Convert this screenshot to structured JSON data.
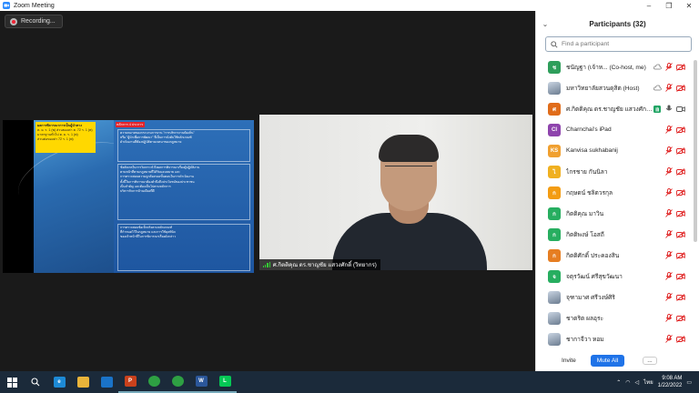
{
  "window": {
    "title": "Zoom Meeting",
    "controls": [
      "–",
      "❐",
      "✕"
    ]
  },
  "recording": {
    "label": "Recording..."
  },
  "share": {
    "left_box_lines": [
      "ผลการพิจารณาการเป็นผู้นำทาง",
      "ต. ย. ร. 1 (พ) ส่วนของค่า ต. 72 ร. 1 (พ)",
      "มาตรฐานทั่วไป ต. ย. ร. 1 (พ)",
      "ส่วนต่อของค่า 72 ร. 1 (พ)"
    ],
    "red_label": "หลักการ 4 ประการ",
    "blocks": [
      "ความหมายของกระบวนการงาน \"การบริหารงานท้องถิ่น\"\nหรือ \"ผู้นำเพื่อการพัฒนา\" ที่เป็นการบังคับใช้หลักเกณฑ์\nดำเนินงานที่ต้องปฏิบัติตามเจตนาของกฎหมาย",
      "ข้อสังเกตในการวิเคราะห์ ถึงผลการพิจารณาเรื่องผู้ปฏิบัติงาน\nตามหน้าที่ตามกฎหมายที่ได้รับมอบหมาย และ\nการตรวจสอบความถูกต้องของขั้นตอนในการดำเนินงาน\nทั้งนี้ในการพิจารณาต้องคำนึงถึงประโยชน์ของประชาชน\nเป็นสำคัญ และต้องเป็นไปตามหลักการ\nบริหารกิจการบ้านเมืองที่ดี",
      "การตรวจสอบข้อเท็จจริงตามหลักเกณฑ์\nที่กำหนดไว้ในกฎหมาย และการใช้ดุลพินิจ\nของเจ้าหน้าที่ในการพิจารณาเรื่องดังกล่าว"
    ]
  },
  "camera": {
    "name": "ศ.กิตติคุณ ดร.ชาญชัย แสวงศักดิ์ (วิทยากร)"
  },
  "participants": {
    "title": "Participants (32)",
    "search_placeholder": "Find a participant",
    "items": [
      {
        "name": "ชนัญฐา (เจ้าห...   (Co-host, me)",
        "initial": "ช",
        "color": "#2e9e5b",
        "cloud": true,
        "raise": false,
        "video": "off"
      },
      {
        "name": "มหาวิทยาลัยสวนดุสิต (Host)",
        "initial": "",
        "color": "#7aa0c8",
        "cloud": true,
        "raise": false,
        "video": "off",
        "photo": true
      },
      {
        "name": "ศ.กิตติคุณ ดร.ชาญชัย แสวงศักดิ์ (...",
        "initial": "ศ",
        "color": "#e06c1a",
        "cloud": false,
        "raise": true,
        "video": "on"
      },
      {
        "name": "Charnchai's iPad",
        "initial": "CI",
        "color": "#8e44ad",
        "cloud": false,
        "raise": false,
        "video": "off"
      },
      {
        "name": "Kanvisa sukhabanij",
        "initial": "KS",
        "color": "#f0a030",
        "cloud": false,
        "raise": false,
        "video": "off"
      },
      {
        "name": "ไกรชาย กันนิลา",
        "initial": "ไ",
        "color": "#f0b020",
        "cloud": false,
        "raise": false,
        "video": "off"
      },
      {
        "name": "กฤษดน์ ชลิตวรกุล",
        "initial": "ก",
        "color": "#f39c12",
        "cloud": false,
        "raise": false,
        "video": "off"
      },
      {
        "name": "กิตติคุณ มาวิน",
        "initial": "ก",
        "color": "#27ae60",
        "cloud": false,
        "raise": false,
        "video": "off"
      },
      {
        "name": "กิตติพงษ์ โอสถี",
        "initial": "ก",
        "color": "#27ae60",
        "cloud": false,
        "raise": false,
        "video": "off"
      },
      {
        "name": "กิตติศักดิ์ ประคองสิน",
        "initial": "ก",
        "color": "#e67e22",
        "cloud": false,
        "raise": false,
        "video": "off"
      },
      {
        "name": "จตุรวัฒน์ ศรีสุขวัฒนา",
        "initial": "จ",
        "color": "#27ae60",
        "cloud": false,
        "raise": false,
        "video": "off"
      },
      {
        "name": "จุฑามาศ ศรีวงษ์ศิริ",
        "initial": "",
        "color": "#7aa0c8",
        "cloud": false,
        "raise": false,
        "video": "off",
        "photo": true
      },
      {
        "name": "ชาตริต ผลอุระ",
        "initial": "",
        "color": "#7aa0c8",
        "cloud": false,
        "raise": false,
        "video": "off",
        "photo": true
      },
      {
        "name": "ชากาจีวา หอม",
        "initial": "",
        "color": "#8a6a50",
        "cloud": false,
        "raise": false,
        "video": "off",
        "photo": true
      }
    ],
    "invite_label": "Invite",
    "mute_all_label": "Mute All",
    "more_label": "..."
  },
  "taskbar": {
    "apps": [
      {
        "name": "start",
        "label": "",
        "color": ""
      },
      {
        "name": "search",
        "label": "",
        "color": ""
      },
      {
        "name": "edge",
        "label": "e",
        "color": "#1d8ad6"
      },
      {
        "name": "file-explorer",
        "label": "",
        "color": "#e9b43a"
      },
      {
        "name": "mail",
        "label": "",
        "color": "#1a73c8"
      },
      {
        "name": "powerpoint",
        "label": "P",
        "color": "#c9411c"
      },
      {
        "name": "chrome",
        "label": "",
        "color": "#2ea043"
      },
      {
        "name": "chrome-2",
        "label": "",
        "color": "#2ea043"
      },
      {
        "name": "word",
        "label": "W",
        "color": "#2b579a"
      },
      {
        "name": "line",
        "label": "L",
        "color": "#06c755"
      }
    ],
    "language": "ไทย",
    "time": "9:08 AM",
    "date": "1/22/2022"
  }
}
